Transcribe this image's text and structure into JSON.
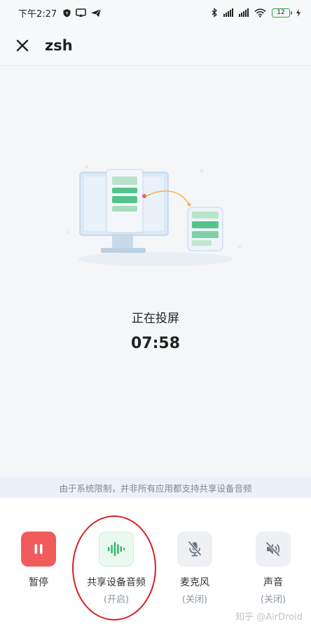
{
  "status_bar": {
    "time": "下午2:27",
    "battery": "12"
  },
  "header": {
    "title": "zsh"
  },
  "main": {
    "status": "正在投屏",
    "timer": "07:58"
  },
  "notice": "由于系统限制，并非所有应用都支持共享设备音频",
  "controls": {
    "pause_label": "暂停",
    "audio_label": "共享设备音频",
    "audio_state": "(开启)",
    "mic_label": "麦克风",
    "mic_state": "(关闭)",
    "sound_label": "声音",
    "sound_state": "(关闭)"
  },
  "watermark": "知乎 @AirDroid",
  "colors": {
    "pause": "#f15b5b",
    "audio_active": "#2fb36b",
    "annotation": "#d61f26"
  }
}
